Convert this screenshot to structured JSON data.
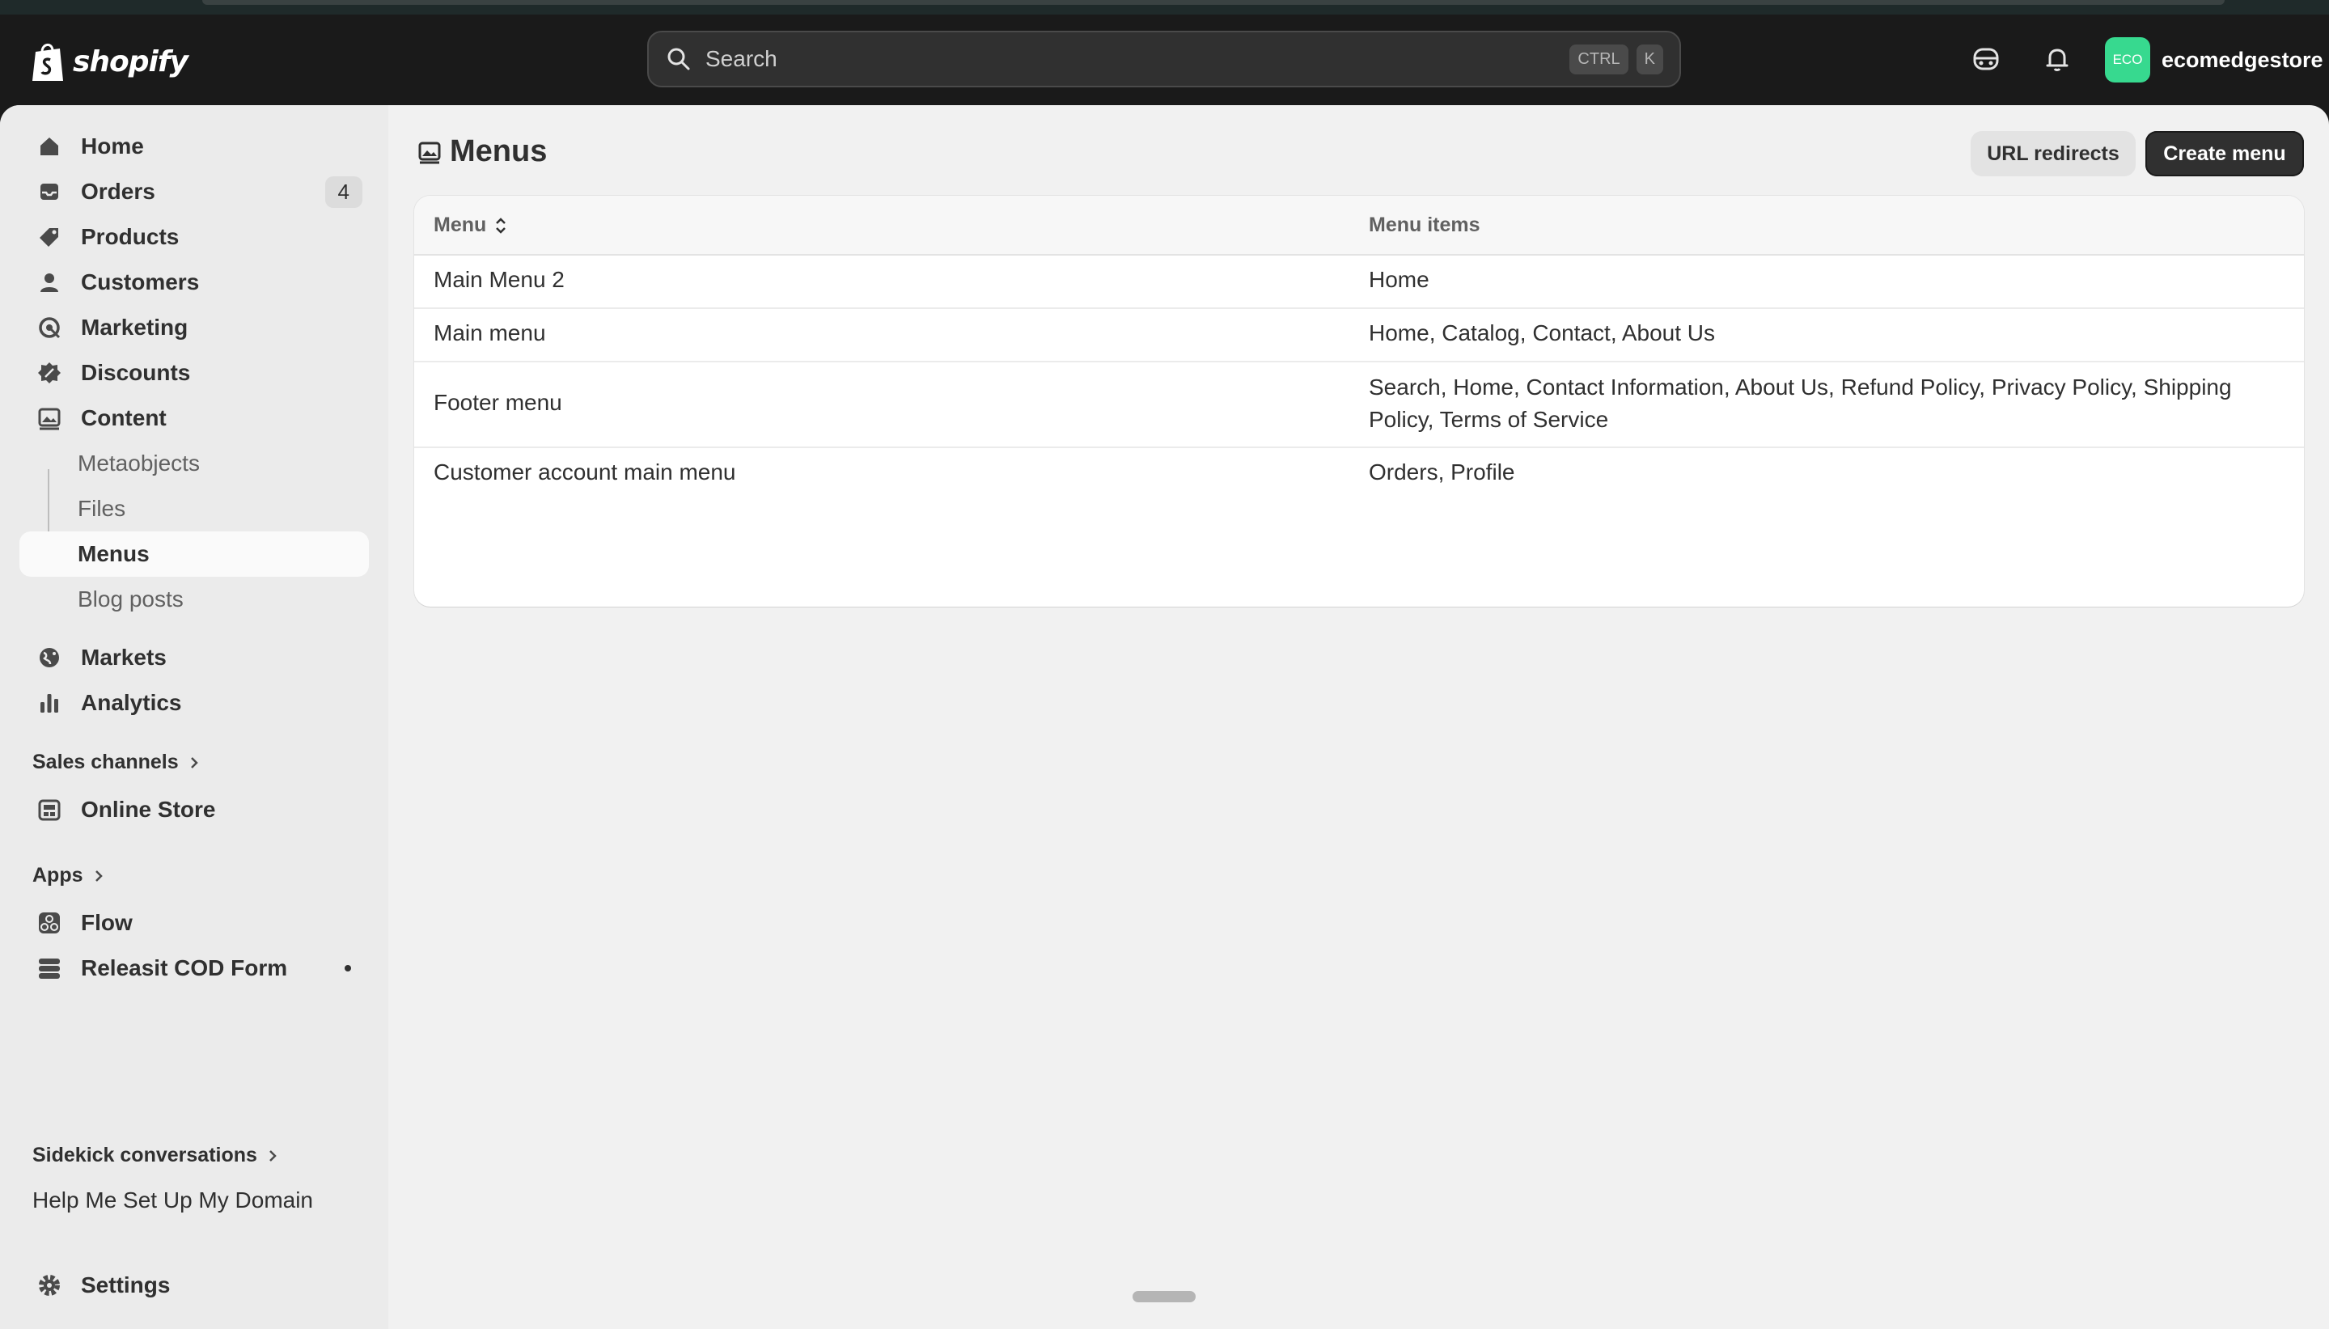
{
  "app": {
    "brand": "shopify"
  },
  "search": {
    "placeholder": "Search",
    "shortcut_ctrl": "CTRL",
    "shortcut_key": "K"
  },
  "user": {
    "avatar_initials": "ECO",
    "store_name": "ecomedgestore",
    "avatar_color": "#37d98f"
  },
  "sidebar": {
    "items": [
      {
        "label": "Home",
        "icon": "home-icon"
      },
      {
        "label": "Orders",
        "icon": "inbox-icon",
        "badge": "4"
      },
      {
        "label": "Products",
        "icon": "tag-icon"
      },
      {
        "label": "Customers",
        "icon": "person-icon"
      },
      {
        "label": "Marketing",
        "icon": "target-icon"
      },
      {
        "label": "Discounts",
        "icon": "discount-icon"
      },
      {
        "label": "Content",
        "icon": "image-icon"
      }
    ],
    "content_sub": [
      "Metaobjects",
      "Files",
      "Menus",
      "Blog posts"
    ],
    "items2": [
      {
        "label": "Markets",
        "icon": "globe-icon"
      },
      {
        "label": "Analytics",
        "icon": "bar-chart-icon"
      }
    ],
    "sales_channels_label": "Sales channels",
    "online_store": "Online Store",
    "apps_label": "Apps",
    "apps": [
      "Flow",
      "Releasit COD Form"
    ],
    "sidekick_label": "Sidekick conversations",
    "sidekick_item": "Help Me Set Up My Domain",
    "settings": "Settings"
  },
  "page": {
    "title": "Menus",
    "url_redirects": "URL redirects",
    "create_menu": "Create menu"
  },
  "table": {
    "col_menu": "Menu",
    "col_items": "Menu items",
    "rows": [
      {
        "menu": "Main Menu 2",
        "items": "Home"
      },
      {
        "menu": "Main menu",
        "items": "Home, Catalog, Contact, About Us"
      },
      {
        "menu": "Footer menu",
        "items": "Search, Home, Contact Information, About Us, Refund Policy, Privacy Policy, Shipping Policy, Terms of Service"
      },
      {
        "menu": "Customer account main menu",
        "items": "Orders, Profile"
      }
    ]
  }
}
